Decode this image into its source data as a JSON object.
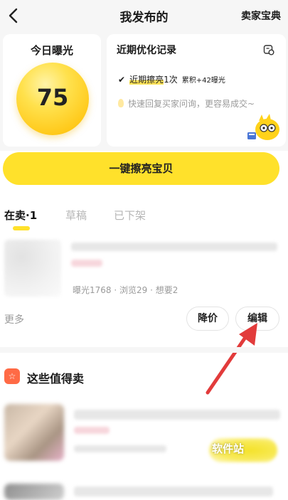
{
  "nav": {
    "title": "我发布的",
    "right_label": "卖家宝典"
  },
  "exposure": {
    "label": "今日曝光",
    "value": "75"
  },
  "record": {
    "title": "近期优化记录",
    "line_check": "✔",
    "line_highlight": "近期擦亮",
    "line_count": "1次",
    "line_total": "累积+42曝光",
    "tip": "快速回复买家问询，更容易成交~"
  },
  "primary_button": "一键擦亮宝贝",
  "tabs": [
    {
      "label": "在卖·1"
    },
    {
      "label": "草稿"
    },
    {
      "label": "已下架"
    }
  ],
  "item": {
    "stats": "曝光1768 · 浏览29 · 想要2",
    "more_label": "更多",
    "reduce_price_label": "降价",
    "edit_label": "编辑"
  },
  "section": {
    "icon_glyph": "☆",
    "title": "这些值得卖"
  },
  "watermark": "软件站",
  "colors": {
    "accent_yellow": "#ffe12b",
    "arrow_red": "#e23b3b",
    "section_icon": "#ff6a45"
  }
}
